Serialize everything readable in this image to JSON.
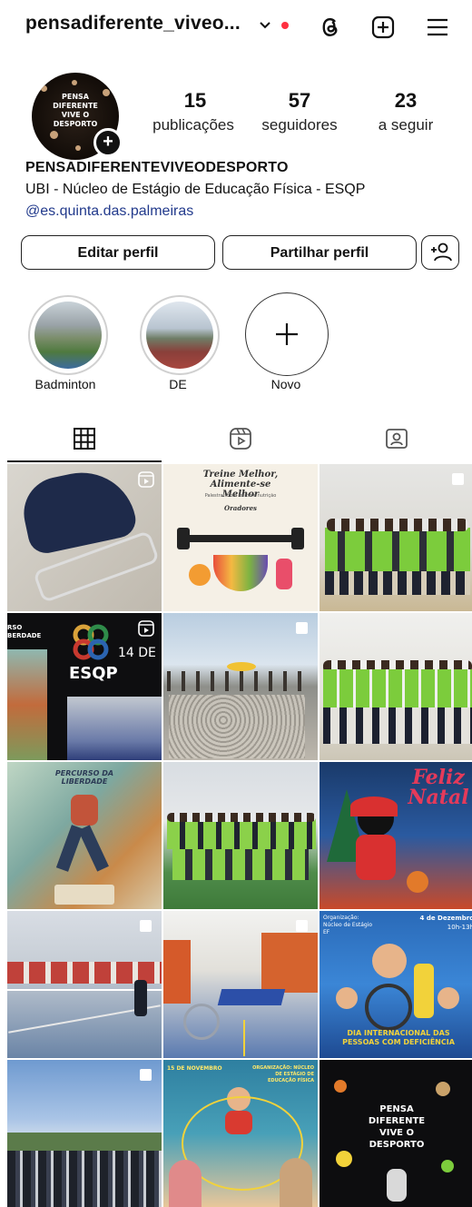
{
  "header": {
    "username": "pensadiferente_viveo...",
    "icons": [
      "chevron-down-icon",
      "notification-dot",
      "threads-icon",
      "new-post-icon",
      "menu-icon"
    ]
  },
  "profile": {
    "avatar_text": "PENSA DIFERENTE VIVE O DESPORTO",
    "stats": [
      {
        "value": "15",
        "label": "publicações"
      },
      {
        "value": "57",
        "label": "seguidores"
      },
      {
        "value": "23",
        "label": "a seguir"
      }
    ],
    "name": "PENSADIFERENTEVIVEODESPORTO",
    "bio": "UBI - Núcleo de Estágio de Educação Física - ESQP",
    "link": "@es.quinta.das.palmeiras"
  },
  "actions": {
    "edit_label": "Editar perfil",
    "share_label": "Partilhar perfil",
    "add_person_icon": "add-person-icon"
  },
  "highlights": [
    {
      "label": "Badminton"
    },
    {
      "label": "DE"
    },
    {
      "label": "Novo"
    }
  ],
  "tabs": [
    "grid-icon",
    "reels-icon",
    "tagged-icon"
  ],
  "posts": {
    "p2_title": "Treine Melhor, Alimente-se Melhor",
    "p2_sub": "Palestra sobre treino e nutrição",
    "p2_speakers_label": "Oradores",
    "p4_logo": "ESQP",
    "p4_date": "14 DE",
    "p4_side": "RSO\nBERDADE",
    "p7_title": "PERCURSO DA LIBERDADE",
    "p9_title": "Feliz Natal",
    "p12_header": "Organização: Núcleo de Estágio EF",
    "p12_date": "4 de Dezembro",
    "p12_time": "10h-13h",
    "p12_footer": "DIA INTERNACIONAL DAS PESSOAS COM DEFICIÊNCIA",
    "p14_date": "15 DE NOVEMBRO",
    "p14_org": "ORGANIZAÇÃO: NÚCLEO DE ESTÁGIO DE EDUCAÇÃO FÍSICA",
    "p15_text": "PENSA DIFERENTE VIVE O DESPORTO"
  }
}
